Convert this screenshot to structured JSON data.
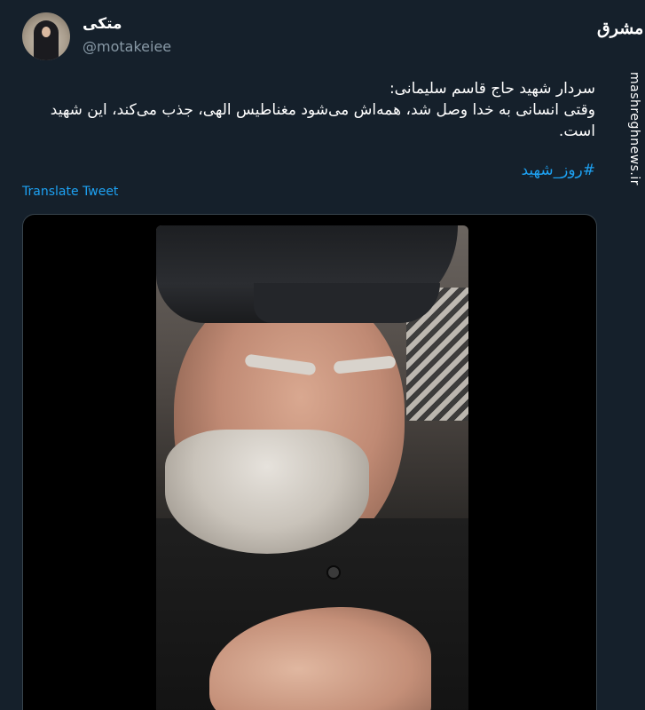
{
  "author": {
    "display_name": "متکی",
    "handle": "@motakeiee"
  },
  "watermark": {
    "logo_text": "مشرق",
    "site": "mashreghnews.ir"
  },
  "tweet": {
    "text": "سردار شهید حاج قاسم سلیمانی:\nوقتی انسانی به خدا وصل شد، همه‌اش می‌شود مغناطیس الهی، جذب می‌کند، این شهید است.",
    "hashtag": "#روز_شهید",
    "translate_label": "Translate Tweet"
  },
  "colors": {
    "background": "#15202b",
    "link": "#1da1f2",
    "secondary_text": "#8899a6"
  }
}
